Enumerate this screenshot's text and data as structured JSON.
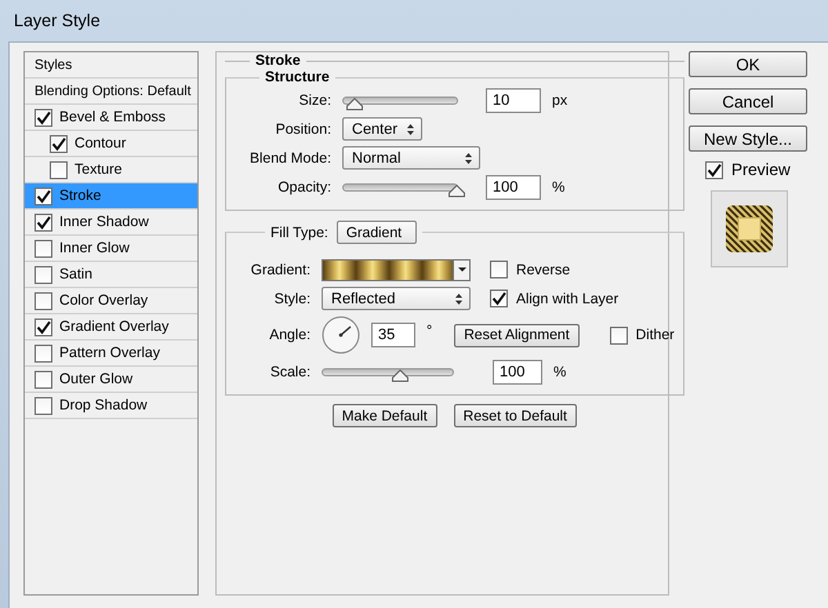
{
  "window": {
    "title": "Layer Style"
  },
  "styles": {
    "header": "Styles",
    "items": [
      {
        "label": "Blending Options: Default",
        "kind": "plain",
        "selected": false
      },
      {
        "label": "Bevel & Emboss",
        "kind": "check",
        "checked": true,
        "selected": false,
        "children": [
          {
            "label": "Contour",
            "kind": "check",
            "checked": true,
            "selected": false
          },
          {
            "label": "Texture",
            "kind": "check",
            "checked": false,
            "selected": false
          }
        ]
      },
      {
        "label": "Stroke",
        "kind": "check",
        "checked": true,
        "selected": true
      },
      {
        "label": "Inner Shadow",
        "kind": "check",
        "checked": true,
        "selected": false
      },
      {
        "label": "Inner Glow",
        "kind": "check",
        "checked": false,
        "selected": false
      },
      {
        "label": "Satin",
        "kind": "check",
        "checked": false,
        "selected": false
      },
      {
        "label": "Color Overlay",
        "kind": "check",
        "checked": false,
        "selected": false
      },
      {
        "label": "Gradient Overlay",
        "kind": "check",
        "checked": true,
        "selected": false
      },
      {
        "label": "Pattern Overlay",
        "kind": "check",
        "checked": false,
        "selected": false
      },
      {
        "label": "Outer Glow",
        "kind": "check",
        "checked": false,
        "selected": false
      },
      {
        "label": "Drop Shadow",
        "kind": "check",
        "checked": false,
        "selected": false
      }
    ]
  },
  "stroke": {
    "title": "Stroke",
    "structure": {
      "title": "Structure",
      "rows": [
        {
          "kind": "slider",
          "label": "Size:",
          "level": 0.1,
          "value": "10",
          "unit": "px"
        },
        {
          "kind": "select",
          "label": "Position:",
          "value": "Center"
        },
        {
          "kind": "select",
          "label": "Blend Mode:",
          "value": "Normal"
        },
        {
          "kind": "slider",
          "label": "Opacity:",
          "level": 1.0,
          "value": "100",
          "unit": "%"
        }
      ]
    },
    "fill": {
      "label": "Fill Type:",
      "value": "Gradient",
      "gradient": {
        "label": "Gradient:"
      },
      "reverse": {
        "label": "Reverse",
        "checked": false
      },
      "style": {
        "label": "Style:",
        "value": "Reflected"
      },
      "align": {
        "label": "Align with Layer",
        "checked": true
      },
      "angle": {
        "label": "Angle:",
        "value": "35",
        "unit": "°"
      },
      "reset_alignment": "Reset Alignment",
      "dither": {
        "label": "Dither",
        "checked": false
      },
      "scale": {
        "label": "Scale:",
        "level": 0.6,
        "value": "100",
        "unit": "%"
      }
    },
    "buttons": [
      "Make Default",
      "Reset to Default"
    ]
  },
  "actions": {
    "buttons": [
      "OK",
      "Cancel",
      "New Style..."
    ],
    "preview": {
      "label": "Preview",
      "checked": true
    }
  }
}
